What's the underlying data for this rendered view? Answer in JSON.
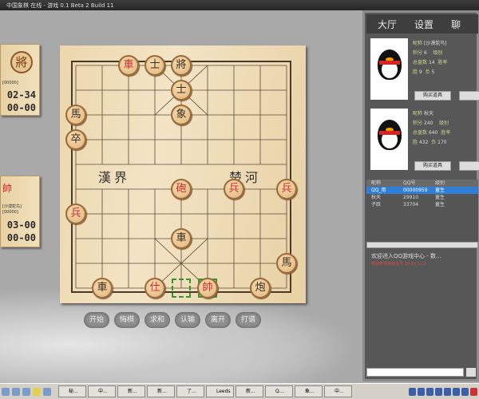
{
  "window": {
    "title": "中国象棋 在线 - 游戏 0.1 Beta 2 Build 11"
  },
  "left_panels": [
    {
      "piece": "將",
      "info": "[00000]",
      "time1": "02-34",
      "time2": "00-00"
    },
    {
      "piece": "帥",
      "info": "[沙漠鸵鸟]",
      "info2": "[00000]",
      "time1": "03-00",
      "time2": "00-00"
    }
  ],
  "board": {
    "river_left": "漢界",
    "river_right": "楚河",
    "pieces": [
      {
        "t": "車",
        "side": "red",
        "col": 2,
        "row": 0
      },
      {
        "t": "士",
        "side": "black",
        "col": 3,
        "row": 0
      },
      {
        "t": "將",
        "side": "black",
        "col": 4,
        "row": 0
      },
      {
        "t": "士",
        "side": "black",
        "col": 4,
        "row": 1
      },
      {
        "t": "象",
        "side": "black",
        "col": 4,
        "row": 2
      },
      {
        "t": "馬",
        "side": "black",
        "col": 0,
        "row": 2
      },
      {
        "t": "卒",
        "side": "black",
        "col": 0,
        "row": 3
      },
      {
        "t": "砲",
        "side": "red",
        "col": 4,
        "row": 5
      },
      {
        "t": "兵",
        "side": "red",
        "col": 6,
        "row": 5
      },
      {
        "t": "兵",
        "side": "red",
        "col": 8,
        "row": 5
      },
      {
        "t": "兵",
        "side": "red",
        "col": 0,
        "row": 6
      },
      {
        "t": "車",
        "side": "black",
        "col": 4,
        "row": 7
      },
      {
        "t": "馬",
        "side": "black",
        "col": 8,
        "row": 8
      },
      {
        "t": "車",
        "side": "black",
        "col": 1,
        "row": 9
      },
      {
        "t": "仕",
        "side": "red",
        "col": 3,
        "row": 9
      },
      {
        "t": "帥",
        "side": "red",
        "col": 5,
        "row": 9
      },
      {
        "t": "炮",
        "side": "black",
        "col": 7,
        "row": 9
      }
    ],
    "last_move": [
      {
        "col": 4,
        "row": 9
      },
      {
        "col": 5,
        "row": 9
      }
    ],
    "highlight_color": "#2c9a2c"
  },
  "actions": [
    "开始",
    "悔棋",
    "求和",
    "认输",
    "离开",
    "打谱"
  ],
  "right": {
    "tabs": [
      "大厅",
      "设置",
      "聊"
    ],
    "players": [
      {
        "nick_label": "昵称",
        "nick": "[沙漠鸵鸟]",
        "score_label": "积分",
        "score": "6",
        "level_label": "级别",
        "total_label": "总盘数",
        "total": "14",
        "rate_label": "胜率",
        "win_label": "胜",
        "win": "9",
        "lose_label": "负",
        "lose": "5",
        "buy": "购买道具"
      },
      {
        "nick_label": "昵称",
        "nick": "秋天",
        "score_label": "积分",
        "score": "240",
        "level_label": "级别",
        "total_label": "总盘数",
        "total": "640",
        "rate_label": "胜率",
        "win_label": "胜",
        "win": "432",
        "lose_label": "负",
        "lose": "170",
        "buy": "购买道具"
      }
    ],
    "list_headers": [
      "昵称",
      "QQ号",
      "级别"
    ],
    "list_rows": [
      {
        "name": "QQ_用",
        "qq": "00000959",
        "level": "童生",
        "selected": true
      },
      {
        "name": "秋天",
        "qq": "29910",
        "level": "童生",
        "selected": false
      },
      {
        "name": "子跃",
        "qq": "33704",
        "level": "童生",
        "selected": false
      }
    ],
    "chat_welcome": "欢迎进入QQ游戏中心 - 数...",
    "chat_notice": "新版象棋游戏本号 20 0n 1.11"
  },
  "taskbar": {
    "tasks": [
      "秘...",
      "中...",
      "新...",
      "新...",
      "了...",
      "Leeds",
      "新...",
      "Q...",
      "象...",
      "中..."
    ]
  }
}
